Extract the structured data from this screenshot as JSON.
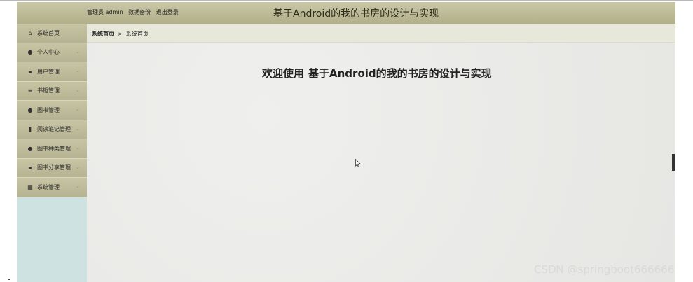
{
  "header": {
    "links": [
      "管理员 admin",
      "数据备份",
      "退出登录"
    ],
    "title": "基于Android的我的书房的设计与实现"
  },
  "sidebar": {
    "items": [
      {
        "label": "系统首页",
        "icon": "home-icon",
        "glyph": "⌂",
        "has_chevron": false
      },
      {
        "label": "个人中心",
        "icon": "user-icon",
        "glyph": "●",
        "has_chevron": true
      },
      {
        "label": "用户管理",
        "icon": "grid-icon",
        "glyph": "▪",
        "has_chevron": true
      },
      {
        "label": "书柜管理",
        "icon": "list-icon",
        "glyph": "≡",
        "has_chevron": true
      },
      {
        "label": "图书管理",
        "icon": "person-icon",
        "glyph": "●",
        "has_chevron": true
      },
      {
        "label": "阅读笔记管理",
        "icon": "bar-chart-icon",
        "glyph": "▮",
        "has_chevron": true
      },
      {
        "label": "图书种类管理",
        "icon": "user-icon",
        "glyph": "●",
        "has_chevron": true
      },
      {
        "label": "图书分享管理",
        "icon": "grid-icon",
        "glyph": "▪",
        "has_chevron": true
      },
      {
        "label": "系统管理",
        "icon": "table-icon",
        "glyph": "▦",
        "has_chevron": true
      }
    ]
  },
  "breadcrumb": {
    "current": "系统首页",
    "separator": ">",
    "page": "系统首页"
  },
  "main": {
    "welcome_prefix": "欢迎使用",
    "welcome_title": "基于Android的我的书房的设计与实现"
  },
  "watermark": "CSDN @springboot666666",
  "colors": {
    "header_bg": "#bdbb98",
    "sidebar_bg": "#cfe2e2",
    "content_bg": "#ededeb"
  }
}
